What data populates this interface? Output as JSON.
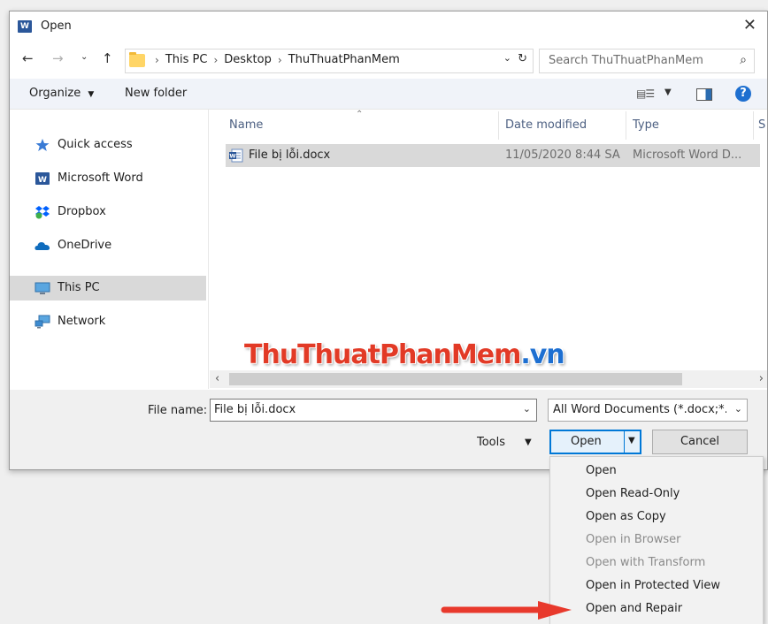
{
  "window": {
    "title": "Open",
    "app_icon": "W"
  },
  "nav": {
    "path": [
      "This PC",
      "Desktop",
      "ThuThuatPhanMem"
    ],
    "search_placeholder": "Search ThuThuatPhanMem"
  },
  "toolbar": {
    "organize": "Organize",
    "new_folder": "New folder",
    "help": "?"
  },
  "sidebar": {
    "items": [
      {
        "label": "Quick access",
        "icon": "star-icon"
      },
      {
        "label": "Microsoft Word",
        "icon": "word-icon"
      },
      {
        "label": "Dropbox",
        "icon": "dropbox-icon"
      },
      {
        "label": "OneDrive",
        "icon": "cloud-icon"
      },
      {
        "label": "This PC",
        "icon": "computer-icon",
        "selected": true
      },
      {
        "label": "Network",
        "icon": "network-icon"
      }
    ]
  },
  "columns": {
    "name": "Name",
    "date": "Date modified",
    "type": "Type",
    "size": "S"
  },
  "files": [
    {
      "name": "File bị lỗi.docx",
      "date": "11/05/2020 8:44 SA",
      "type": "Microsoft Word D..."
    }
  ],
  "watermark": {
    "part1": "ThuThuat",
    "part2": "PhanMem",
    "part3": ".vn"
  },
  "footer": {
    "file_name_label": "File name:",
    "file_name_value": "File bị lỗi.docx",
    "file_type": "All Word Documents (*.docx;*.docm)",
    "tools": "Tools",
    "open": "Open",
    "cancel": "Cancel"
  },
  "open_menu": [
    {
      "label": "Open",
      "disabled": false
    },
    {
      "label": "Open Read-Only",
      "disabled": false
    },
    {
      "label": "Open as Copy",
      "disabled": false
    },
    {
      "label": "Open in Browser",
      "disabled": true
    },
    {
      "label": "Open with Transform",
      "disabled": true
    },
    {
      "label": "Open in Protected View",
      "disabled": false
    },
    {
      "label": "Open and Repair",
      "disabled": false
    }
  ],
  "colors": {
    "accent": "#0078d7",
    "annotation_arrow": "#e8392c"
  }
}
